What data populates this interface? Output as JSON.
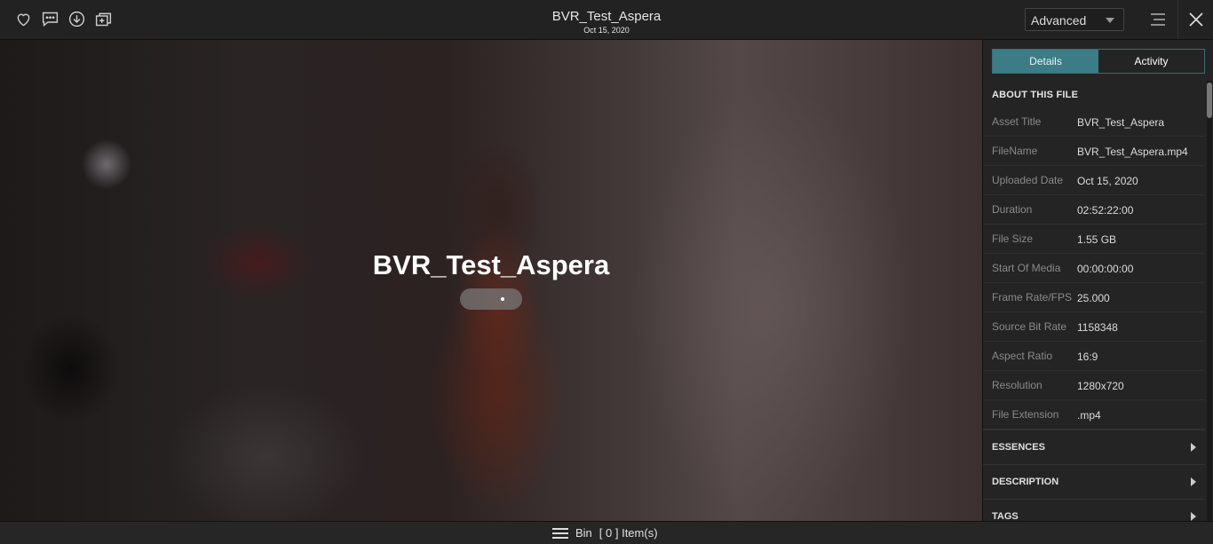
{
  "header": {
    "title": "BVR_Test_Aspera",
    "date": "Oct 15, 2020",
    "mode_select": {
      "value": "Advanced"
    },
    "icons": [
      "heart-icon",
      "comment-icon",
      "download-icon",
      "add-to-collection-icon",
      "menu-icon",
      "close-icon"
    ]
  },
  "player": {
    "overlay_title": "BVR_Test_Aspera"
  },
  "sidebar": {
    "tabs": [
      {
        "label": "Details",
        "active": true
      },
      {
        "label": "Activity",
        "active": false
      }
    ],
    "about_heading": "ABOUT THIS FILE",
    "rows": [
      {
        "key": "Asset Title",
        "value": "BVR_Test_Aspera"
      },
      {
        "key": "FileName",
        "value": "BVR_Test_Aspera.mp4"
      },
      {
        "key": "Uploaded Date",
        "value": "Oct 15, 2020"
      },
      {
        "key": "Duration",
        "value": "02:52:22:00"
      },
      {
        "key": "File Size",
        "value": "1.55 GB"
      },
      {
        "key": "Start Of Media",
        "value": "00:00:00:00"
      },
      {
        "key": "Frame Rate/FPS",
        "value": "25.000"
      },
      {
        "key": "Source Bit Rate",
        "value": "1158348"
      },
      {
        "key": "Aspect Ratio",
        "value": "16:9"
      },
      {
        "key": "Resolution",
        "value": "1280x720"
      },
      {
        "key": "File Extension",
        "value": ".mp4"
      }
    ],
    "sections": [
      {
        "label": "ESSENCES"
      },
      {
        "label": "DESCRIPTION"
      },
      {
        "label": "TAGS"
      }
    ]
  },
  "footer": {
    "bin_label": "Bin",
    "items_label": "[ 0 ] Item(s)"
  },
  "colors": {
    "accent": "#3b7c86",
    "background": "#1c1c1c"
  }
}
